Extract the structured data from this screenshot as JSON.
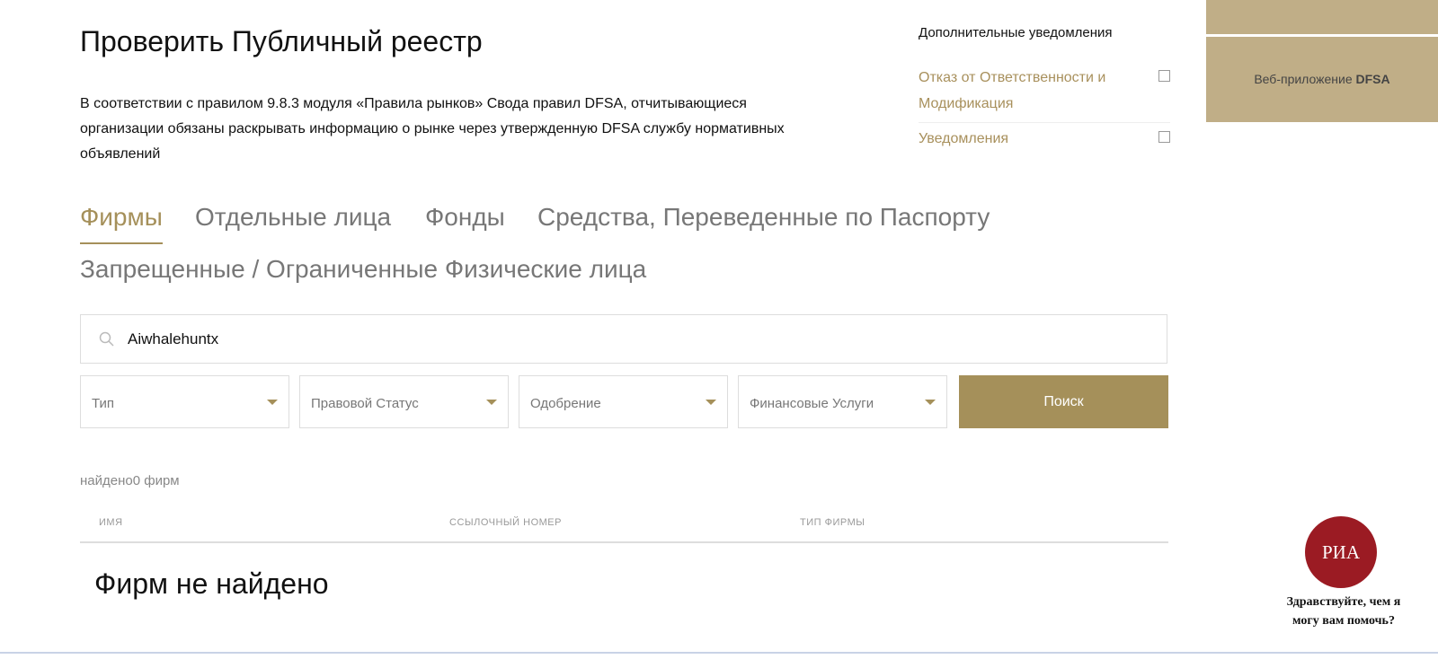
{
  "title": "Проверить Публичный реестр",
  "intro": "В соответствии с правилом 9.8.3 модуля «Правила рынков» Свода правил DFSA, отчитывающиеся организации обязаны раскрывать информацию о рынке через утвержденную DFSA службу нормативных объявлений",
  "notices": {
    "title": "Дополнительные уведомления",
    "links": [
      "Отказ от Ответственности и Модификация",
      "Уведомления"
    ]
  },
  "panel": {
    "label": "Веб-приложение ",
    "brand": "DFSA"
  },
  "tabs": [
    "Фирмы",
    "Отдельные лица",
    "Фонды",
    "Средства, Переведенные по Паспорту",
    "Запрещенные / Ограниченные Физические лица"
  ],
  "search": {
    "value": "Aiwhalehuntx"
  },
  "filters": [
    "Тип",
    "Правовой Статус",
    "Одобрение",
    "Финансовые Услуги"
  ],
  "search_button": "Поиск",
  "result_count": "найдено0 фирм",
  "columns": [
    "ИМЯ",
    "ССЫЛОЧНЫЙ НОМЕР",
    "ТИП ФИРМЫ"
  ],
  "empty": "Фирм не найдено",
  "chat": {
    "logo": "РИА",
    "greeting": "Здравствуйте, чем я могу вам помочь?"
  },
  "colors": {
    "accent": "#a5905a",
    "panel": "#c0ae87",
    "chat": "#9b1b23"
  }
}
